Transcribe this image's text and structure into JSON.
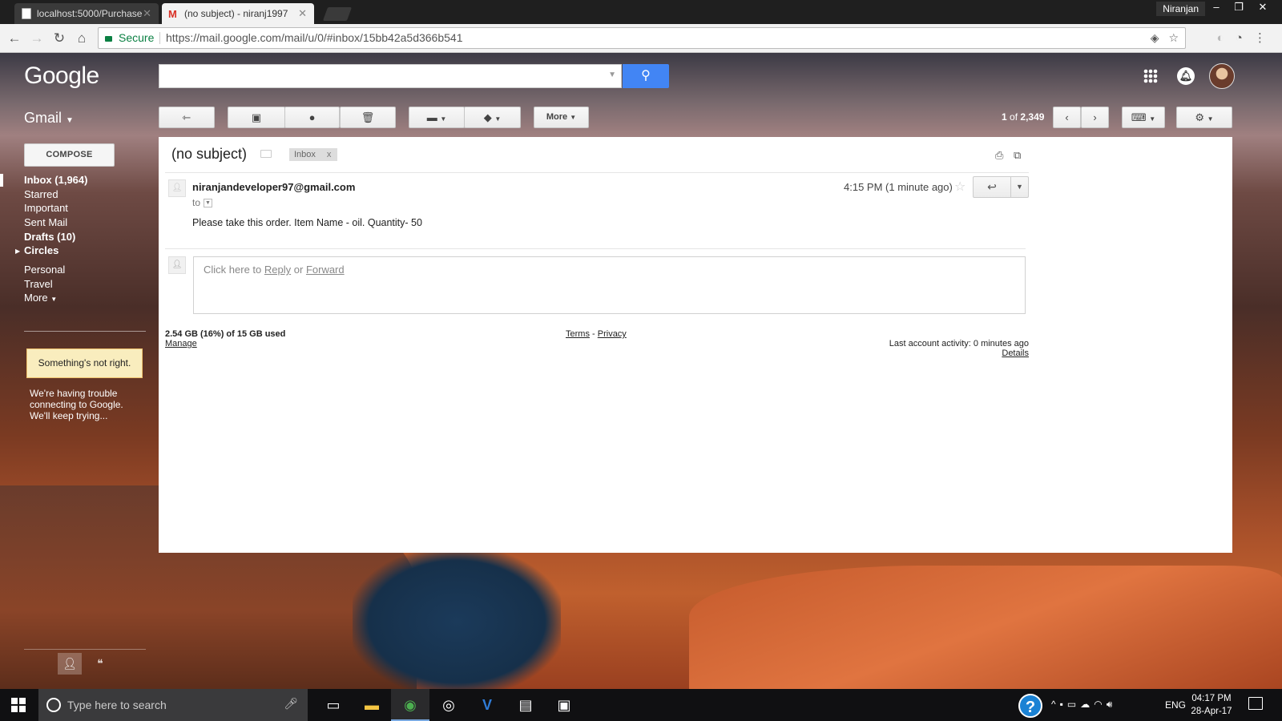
{
  "browser": {
    "tabs": [
      {
        "title": "localhost:5000/Purchase",
        "active": false
      },
      {
        "title": "(no subject) - niranj1997",
        "active": true
      }
    ],
    "user": "Niranjan",
    "secure_label": "Secure",
    "url": "https://mail.google.com/mail/u/0/#inbox/15bb42a5d366b541",
    "icons": {
      "back": "arrow-left-icon",
      "forward": "arrow-right-icon",
      "reload": "reload-icon",
      "home": "home-icon",
      "star": "star-icon"
    }
  },
  "gmail": {
    "logo": "Google",
    "app_label": "Gmail",
    "search": {
      "placeholder": ""
    },
    "toolbar": {
      "more_label": "More"
    },
    "pager": {
      "current": "1",
      "of_word": "of",
      "total": "2,349"
    },
    "compose_label": "COMPOSE",
    "nav": [
      {
        "label": "Inbox (1,964)",
        "bold": true
      },
      {
        "label": "Starred",
        "bold": false
      },
      {
        "label": "Important",
        "bold": false
      },
      {
        "label": "Sent Mail",
        "bold": false
      },
      {
        "label": "Drafts (10)",
        "bold": true
      },
      {
        "label": "Circles",
        "bold": true
      },
      {
        "label": "Personal",
        "bold": false
      },
      {
        "label": "Travel",
        "bold": false
      },
      {
        "label": "More",
        "bold": false
      }
    ],
    "warning": {
      "title": "Something's not right.",
      "message": "We're having trouble connecting to Google. We'll keep trying..."
    }
  },
  "message": {
    "subject": "(no subject)",
    "label": "Inbox",
    "label_remove": "x",
    "sender": "niranjandeveloper97@gmail.com",
    "to_label": "to",
    "time": "4:15 PM (1 minute ago)",
    "body": "Please take this order. Item Name - oil. Quantity- 50",
    "reply_prompt_prefix": "Click here to",
    "reply_link": "Reply",
    "reply_or": "or",
    "forward_link": "Forward"
  },
  "footer": {
    "storage": "2.54 GB (16%) of 15 GB used",
    "manage": "Manage",
    "terms": "Terms",
    "sep": "-",
    "privacy": "Privacy",
    "last_activity": "Last account activity: 0 minutes ago",
    "details": "Details"
  },
  "taskbar": {
    "search_placeholder": "Type here to search",
    "lang": "ENG",
    "time": "04:17 PM",
    "date": "28-Apr-17"
  }
}
